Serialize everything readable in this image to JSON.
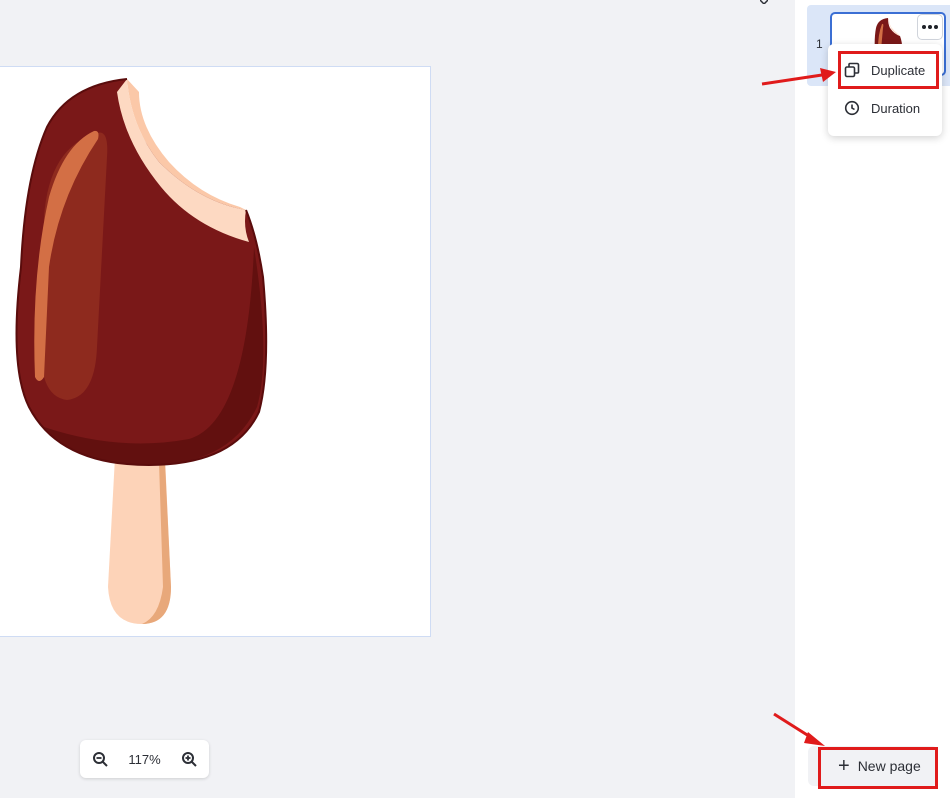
{
  "canvas": {
    "image_name": "chocolate-popsicle-illustration"
  },
  "zoom": {
    "value": "117%",
    "zoom_out_icon": "zoom-out-icon",
    "zoom_in_icon": "zoom-in-icon"
  },
  "pages_panel": {
    "page_number": "1",
    "more_icon": "more-horizontal-icon",
    "context_menu": {
      "items": [
        {
          "label": "Duplicate",
          "icon": "duplicate-icon"
        },
        {
          "label": "Duration",
          "icon": "clock-icon"
        }
      ]
    },
    "new_page_label": "New page",
    "new_page_icon": "plus-icon"
  },
  "colors": {
    "accent": "#3b6fd4",
    "annotation_red": "#e01b1b",
    "chocolate": "#7a1818",
    "stick": "#fdd3b8"
  }
}
